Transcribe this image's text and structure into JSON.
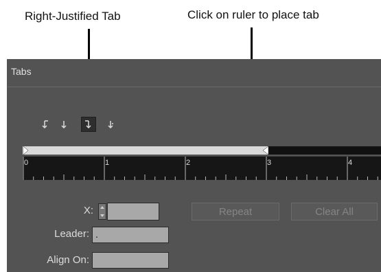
{
  "callouts": {
    "right_justified": "Right-Justified Tab",
    "click_ruler": "Click on ruler to place tab"
  },
  "panel": {
    "title": "Tabs",
    "tab_buttons": [
      {
        "name": "left-justified-tab-icon",
        "selected": false
      },
      {
        "name": "center-justified-tab-icon",
        "selected": false
      },
      {
        "name": "right-justified-tab-icon",
        "selected": true
      },
      {
        "name": "align-to-decimal-tab-icon",
        "selected": false
      }
    ],
    "ruler": {
      "numbers": [
        "0",
        "1",
        "2",
        "3",
        "4"
      ]
    },
    "x_label": "X:",
    "x_value": "",
    "leader_label": "Leader:",
    "leader_value": ".",
    "align_on_label": "Align On:",
    "align_on_value": "",
    "repeat_label": "Repeat",
    "clear_all_label": "Clear All"
  }
}
